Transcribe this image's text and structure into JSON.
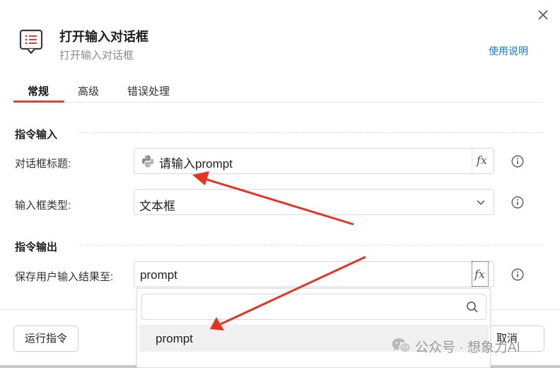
{
  "dialog": {
    "title": "打开输入对话框",
    "subtitle": "打开输入对话框",
    "help_link": "使用说明",
    "close_icon": "close-icon",
    "header_icon": "dialog-list-icon"
  },
  "tabs": [
    {
      "label": "常规",
      "active": true
    },
    {
      "label": "高级",
      "active": false
    },
    {
      "label": "错误处理",
      "active": false
    }
  ],
  "input_section": {
    "title": "指令输入",
    "fields": [
      {
        "label": "对话框标题:",
        "value": "请输入prompt",
        "icon": "python-icon",
        "fx": "fx"
      },
      {
        "label": "输入框类型:",
        "value": "文本框",
        "icon": "chevron-down-icon"
      }
    ]
  },
  "output_section": {
    "title": "指令输出",
    "fields": [
      {
        "label": "保存用户输入结果至:",
        "value": "prompt",
        "fx": "fx"
      }
    ]
  },
  "dropdown": {
    "search_placeholder": "",
    "search_icon": "search-icon",
    "items": [
      "prompt"
    ]
  },
  "footer": {
    "run_button": "运行指令",
    "cancel_button": "取消"
  },
  "watermark": {
    "text": "公众号 · 想象力AI",
    "icon": "wechat-icon"
  },
  "colors": {
    "accent_red": "#e0413a",
    "link_blue": "#1677d9",
    "annotation_arrow": "#e53325"
  }
}
